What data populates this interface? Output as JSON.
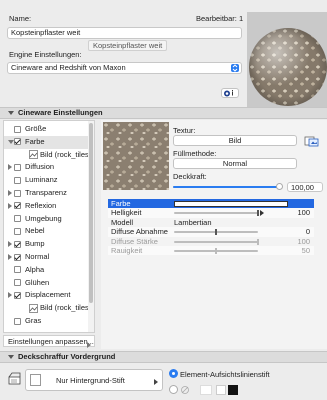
{
  "header": {
    "name_label": "Name:",
    "edited_label": "Bearbeitbar: 1",
    "name_value": "Kopsteinpflaster weit",
    "tooltip": "Kopsteinpflaster weit"
  },
  "engine": {
    "label": "Engine Einstellungen:",
    "value": "Cineware and Redshift von Maxon"
  },
  "cineware": {
    "title": "Cineware Einstellungen",
    "channels": [
      {
        "label": "Größe",
        "checked": false,
        "expandable": false
      },
      {
        "label": "Farbe",
        "checked": true,
        "expandable": true,
        "selected": true
      },
      {
        "label": "Bild (rock_tiles_p",
        "checked": true,
        "sub": true
      },
      {
        "label": "Diffusion",
        "checked": false,
        "expandable": true
      },
      {
        "label": "Luminanz",
        "checked": false
      },
      {
        "label": "Transparenz",
        "checked": false,
        "expandable": true
      },
      {
        "label": "Reflexion",
        "checked": true,
        "expandable": true
      },
      {
        "label": "Umgebung",
        "checked": false
      },
      {
        "label": "Nebel",
        "checked": false
      },
      {
        "label": "Bump",
        "checked": true,
        "expandable": true
      },
      {
        "label": "Normal",
        "checked": true,
        "expandable": true
      },
      {
        "label": "Alpha",
        "checked": false
      },
      {
        "label": "Glühen",
        "checked": false
      },
      {
        "label": "Displacement",
        "checked": true,
        "expandable": true
      },
      {
        "label": "Bild (rock_tiles_p",
        "checked": true,
        "sub": true
      },
      {
        "label": "Gras",
        "checked": false
      }
    ],
    "adjust_label": "Einstellungen anpassen...",
    "texture_label": "Textur:",
    "texture_button": "Bild",
    "fill_label": "Füllmethode:",
    "fill_value": "Normal",
    "opacity_label": "Deckkraft:",
    "opacity_value": "100,00",
    "opacity_level": 1.0,
    "properties": [
      {
        "key": "Farbe",
        "value": "",
        "selected": true,
        "swatch": "#ffffff"
      },
      {
        "key": "Helligkeit",
        "value": "100",
        "slider": 1.0
      },
      {
        "key": "Modell",
        "value": "Lambertian",
        "left_value": true
      },
      {
        "key": "Diffuse Abnahme",
        "value": "0",
        "slider": 0.5
      },
      {
        "key": "Diffuse Stärke",
        "value": "100",
        "slider": 1.0,
        "disabled": true
      },
      {
        "key": "Rauigkeit",
        "value": "50",
        "slider": 0.5,
        "disabled": true
      }
    ]
  },
  "fill": {
    "title": "Deckschraffur Vordergrund",
    "pen_value": "Nur Hintergrund-Stift",
    "option1": "Element-Aufsichtslinienstift",
    "selected_option": 1
  },
  "colors": {
    "selection": "#2368e1",
    "accent": "#2a7cf0"
  }
}
